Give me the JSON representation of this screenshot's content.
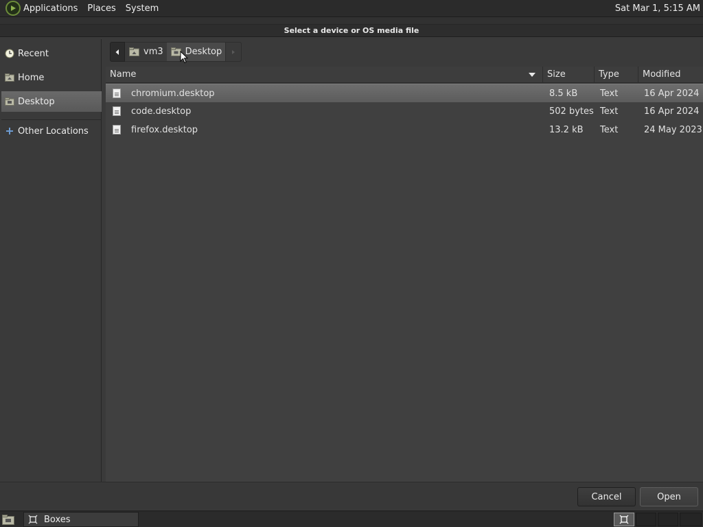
{
  "top_panel": {
    "menus": [
      "Applications",
      "Places",
      "System"
    ],
    "clock": "Sat Mar  1,  5:15 AM"
  },
  "dialog": {
    "title": "Select a device or OS media file"
  },
  "sidebar": {
    "items": [
      {
        "label": "Recent",
        "icon": "clock-icon"
      },
      {
        "label": "Home",
        "icon": "home-folder-icon"
      },
      {
        "label": "Desktop",
        "icon": "desktop-folder-icon",
        "selected": true
      },
      {
        "label": "Other Locations",
        "icon": "plus-icon"
      }
    ]
  },
  "pathbar": {
    "crumbs": [
      {
        "label": "vm3",
        "icon": "home-folder-icon"
      },
      {
        "label": "Desktop",
        "icon": "desktop-folder-icon",
        "active": true
      }
    ]
  },
  "filelist": {
    "columns": {
      "name": "Name",
      "size": "Size",
      "type": "Type",
      "modified": "Modified"
    },
    "sort": "name-descending",
    "rows": [
      {
        "name": "chromium.desktop",
        "size": "8.5 kB",
        "type": "Text",
        "modified": "16 Apr 2024",
        "selected": true
      },
      {
        "name": "code.desktop",
        "size": "502 bytes",
        "type": "Text",
        "modified": "16 Apr 2024"
      },
      {
        "name": "firefox.desktop",
        "size": "13.2 kB",
        "type": "Text",
        "modified": "24 May 2023"
      }
    ]
  },
  "buttons": {
    "cancel": "Cancel",
    "open": "Open"
  },
  "taskbar": {
    "window": "Boxes",
    "window_icon": "boxes-icon"
  },
  "colors": {
    "background": "#3a3a3a",
    "panel": "#2b2b2b",
    "selection": "#656565",
    "logo_accent": "#6d8d3a"
  }
}
